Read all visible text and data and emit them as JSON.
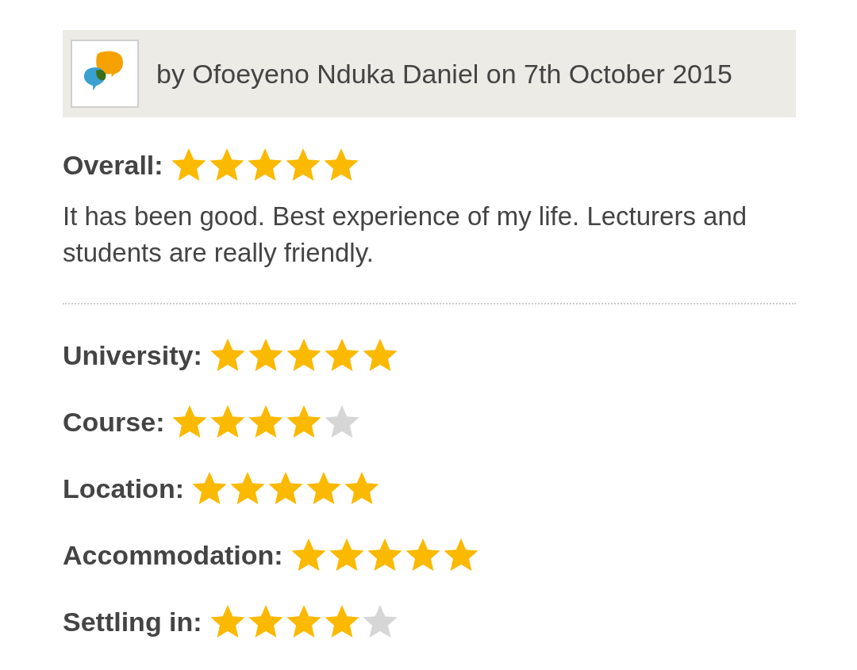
{
  "review": {
    "byline": "by Ofoeyeno Nduka Daniel on 7th October 2015",
    "overall": {
      "label": "Overall:",
      "stars": 5
    },
    "comment": "It has been good. Best experience of my life. Lecturers and students are really friendly.",
    "ratings": [
      {
        "label": "University:",
        "stars": 5
      },
      {
        "label": "Course:",
        "stars": 4
      },
      {
        "label": "Location:",
        "stars": 5
      },
      {
        "label": "Accommodation:",
        "stars": 5
      },
      {
        "label": "Settling in:",
        "stars": 4
      }
    ]
  }
}
